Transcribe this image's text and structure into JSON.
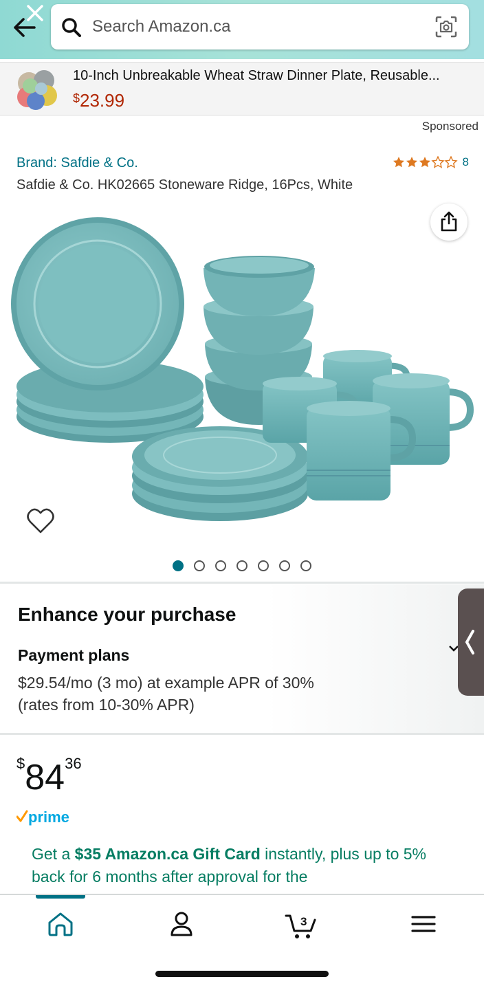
{
  "header": {
    "search_placeholder": "Search Amazon.ca",
    "icons": [
      "back-arrow-icon",
      "close-icon",
      "search-icon",
      "camera-lens-icon"
    ],
    "accent_color": "#a3dfd8"
  },
  "sponsored_banner": {
    "title": "10-Inch Unbreakable Wheat Straw Dinner Plate, Reusable...",
    "price_currency": "$",
    "price_amount": "23.99",
    "sponsored_label": "Sponsored"
  },
  "product": {
    "brand": "Brand: Safdie & Co.",
    "rating_stars": 3.5,
    "rating_count": "8",
    "title": "Safdie & Co. HK02665 Stoneware Ridge, 16Pcs, White",
    "image_count": 7,
    "image_index": 1
  },
  "enhance": {
    "heading": "Enhance your purchase",
    "payment_title": "Payment plans",
    "payment_line1": "$29.54/mo (3 mo) at example APR of 30%",
    "payment_line2": "(rates from 10-30% APR)"
  },
  "price": {
    "currency": "$",
    "whole": "84",
    "fraction": "36"
  },
  "prime_label": "prime",
  "gift_offer": {
    "prefix": "Get a ",
    "highlight": "$35 Amazon.ca Gift Card",
    "rest": " instantly, plus up to 5% back for 6 months after approval for the"
  },
  "bottom_nav": {
    "cart_count": "3",
    "items": [
      "home-icon",
      "account-icon",
      "cart-icon",
      "menu-icon"
    ]
  },
  "colors": {
    "link_teal": "#007185",
    "price_red": "#b12704",
    "offer_green": "#067d62",
    "star_orange": "#de7921"
  }
}
